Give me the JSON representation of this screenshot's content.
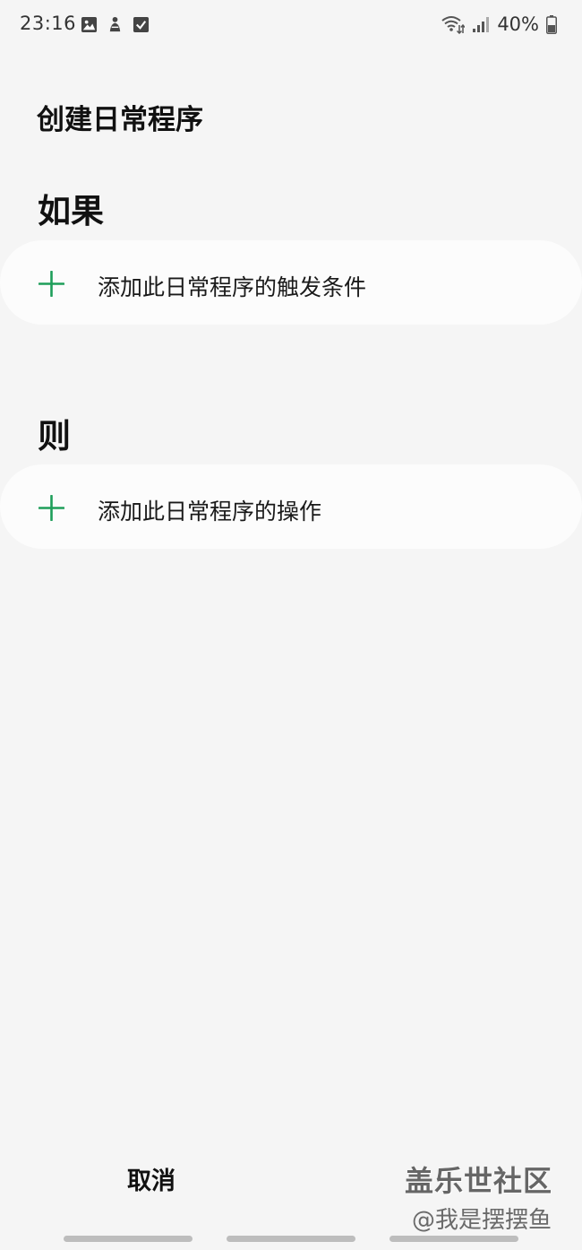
{
  "status_bar": {
    "time": "23:16",
    "battery": "40%",
    "left_icons": [
      "gallery-icon",
      "fitness-icon",
      "checkbox-icon"
    ],
    "right_icons": [
      "wifi-icon",
      "signal-icon",
      "battery-icon"
    ]
  },
  "page": {
    "title": "创建日常程序"
  },
  "if_section": {
    "heading": "如果",
    "add_label": "添加此日常程序的触发条件"
  },
  "then_section": {
    "heading": "则",
    "add_label": "添加此日常程序的操作"
  },
  "bottom_bar": {
    "cancel_label": "取消"
  },
  "watermark": {
    "title": "盖乐世社区",
    "user": "@我是摆摆鱼"
  },
  "colors": {
    "accent": "#1e9e5a",
    "background": "#f5f5f5",
    "card": "#fcfcfc"
  }
}
